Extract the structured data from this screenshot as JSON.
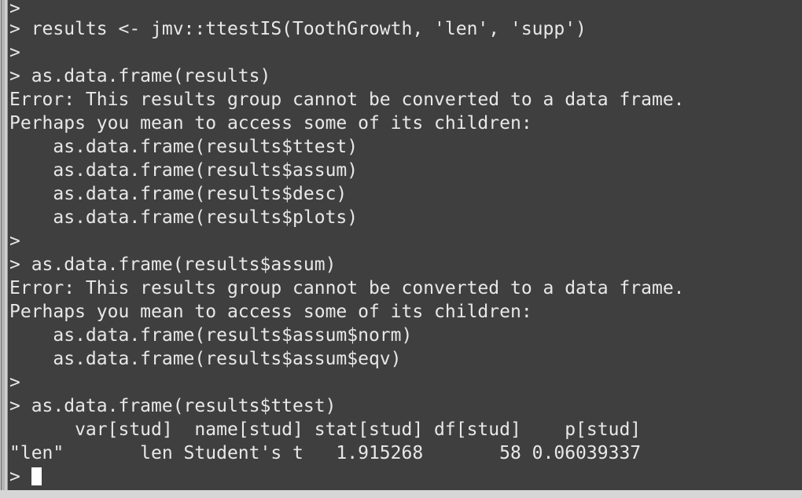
{
  "terminal": {
    "app": "R Console",
    "prompt_symbol": ">",
    "colors": {
      "background": "#3f3f3f",
      "foreground": "#e8e8e8",
      "cursor": "#ffffff",
      "gutter": "#bdbdbd",
      "window_chrome": "#d6d6d6"
    },
    "lines": [
      {
        "kind": "prompt",
        "text": ">"
      },
      {
        "kind": "command",
        "text": "> results <- jmv::ttestIS(ToothGrowth, 'len', 'supp')"
      },
      {
        "kind": "prompt",
        "text": ">"
      },
      {
        "kind": "command",
        "text": "> as.data.frame(results)"
      },
      {
        "kind": "error",
        "text": "Error: This results group cannot be converted to a data frame."
      },
      {
        "kind": "error",
        "text": "Perhaps you mean to access some of its children:"
      },
      {
        "kind": "output",
        "text": "    as.data.frame(results$ttest)"
      },
      {
        "kind": "output",
        "text": "    as.data.frame(results$assum)"
      },
      {
        "kind": "output",
        "text": "    as.data.frame(results$desc)"
      },
      {
        "kind": "output",
        "text": "    as.data.frame(results$plots)"
      },
      {
        "kind": "prompt",
        "text": ">"
      },
      {
        "kind": "command",
        "text": "> as.data.frame(results$assum)"
      },
      {
        "kind": "error",
        "text": "Error: This results group cannot be converted to a data frame."
      },
      {
        "kind": "error",
        "text": "Perhaps you mean to access some of its children:"
      },
      {
        "kind": "output",
        "text": "    as.data.frame(results$assum$norm)"
      },
      {
        "kind": "output",
        "text": "    as.data.frame(results$assum$eqv)"
      },
      {
        "kind": "prompt",
        "text": ">"
      },
      {
        "kind": "command",
        "text": "> as.data.frame(results$ttest)"
      },
      {
        "kind": "table-header",
        "text": "      var[stud]  name[stud] stat[stud] df[stud]    p[stud]"
      },
      {
        "kind": "table-row",
        "text": "\"len\"       len Student's t   1.915268       58 0.06039337"
      }
    ],
    "current_prompt": "> ",
    "cursor_visible": true
  },
  "result_table": {
    "columns": [
      "var[stud]",
      "name[stud]",
      "stat[stud]",
      "df[stud]",
      "p[stud]"
    ],
    "row_label": "\"len\"",
    "rows": [
      {
        "var[stud]": "len",
        "name[stud]": "Student's t",
        "stat[stud]": "1.915268",
        "df[stud]": "58",
        "p[stud]": "0.06039337"
      }
    ]
  }
}
